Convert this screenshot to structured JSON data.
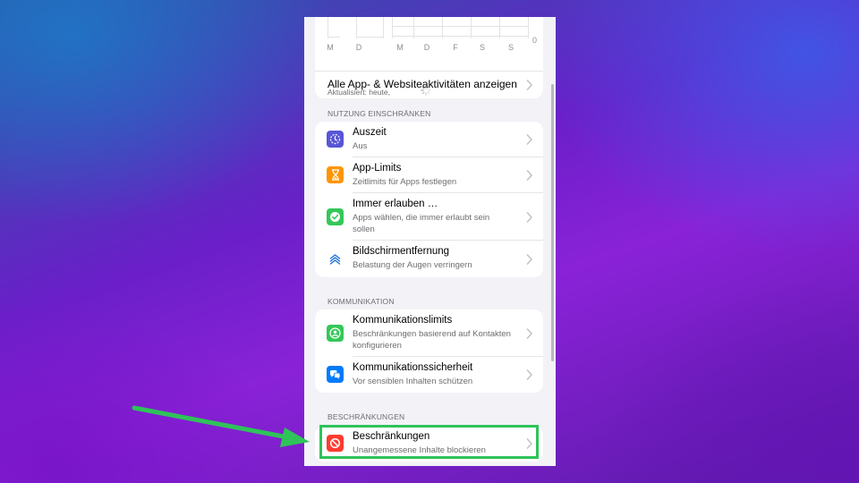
{
  "usage_chart": {
    "day_labels": [
      "M",
      "D",
      "M",
      "D",
      "F",
      "S",
      "S"
    ],
    "zero_label": "0"
  },
  "all_activity": {
    "label": "Alle App- & Websiteaktivitäten anzeigen"
  },
  "updated_text": "Aktualisiert: heute,",
  "sections": {
    "limit_usage": {
      "header": "NUTZUNG EINSCHRÄNKEN",
      "items": [
        {
          "title": "Auszeit",
          "subtitle": "Aus",
          "icon": "downtime-icon",
          "color": "#5856d6"
        },
        {
          "title": "App-Limits",
          "subtitle": "Zeitlimits für Apps festlegen",
          "icon": "hourglass-icon",
          "color": "#ff9500"
        },
        {
          "title": "Immer erlauben …",
          "subtitle": "Apps wählen, die immer erlaubt sein sollen",
          "icon": "checkmark-badge-icon",
          "color": "#34c759"
        },
        {
          "title": "Bildschirmentfernung",
          "subtitle": "Belastung der Augen verringern",
          "icon": "screen-distance-icon",
          "color": "#ffffff"
        }
      ]
    },
    "communication": {
      "header": "KOMMUNIKATION",
      "items": [
        {
          "title": "Kommunikationslimits",
          "subtitle": "Beschränkungen basierend auf Kontakten konfigurieren",
          "icon": "contact-icon",
          "color": "#34c759"
        },
        {
          "title": "Kommunikationssicherheit",
          "subtitle": "Vor sensiblen Inhalten schützen",
          "icon": "chat-bubbles-icon",
          "color": "#007aff"
        }
      ]
    },
    "restrictions": {
      "header": "BESCHRÄNKUNGEN",
      "items": [
        {
          "title": "Beschränkungen",
          "subtitle": "Unangemessene Inhalte blockieren",
          "icon": "prohibited-icon",
          "color": "#ff3b30"
        }
      ]
    }
  },
  "annotation": {
    "highlight_color": "#2fc35a"
  }
}
